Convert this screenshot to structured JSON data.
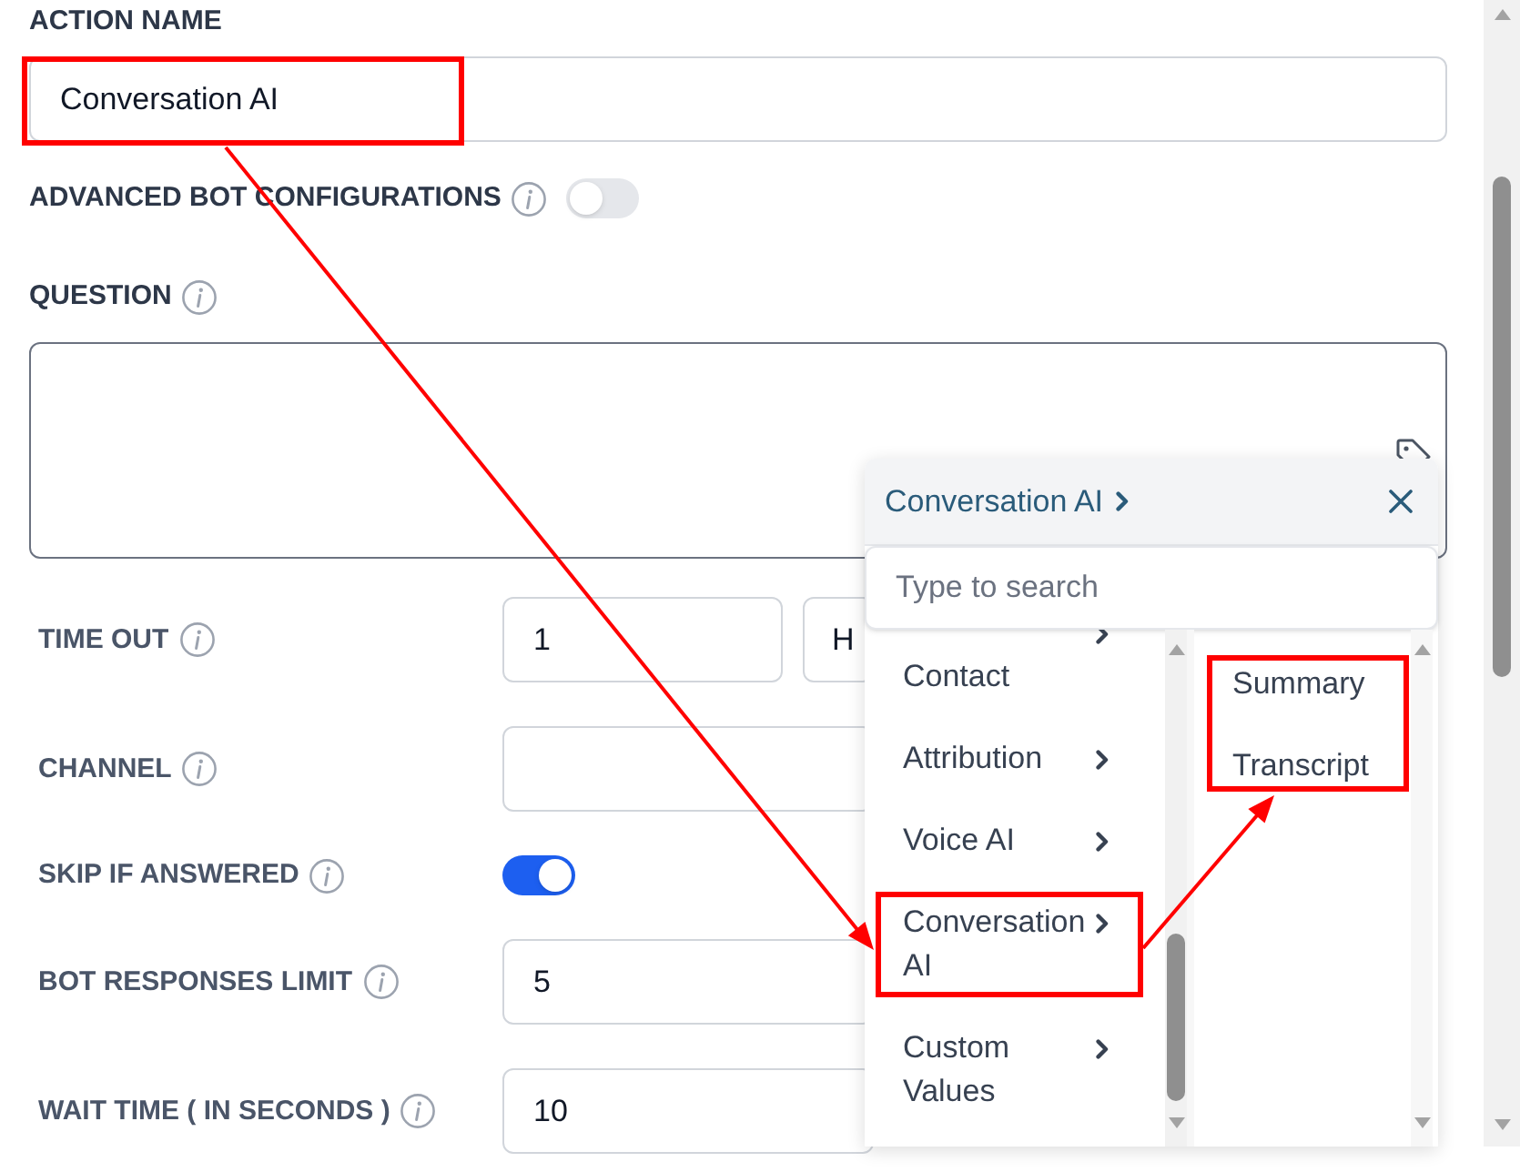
{
  "form": {
    "action_name": {
      "label": "ACTION NAME",
      "value": "Conversation AI",
      "highlighted": true
    },
    "advanced": {
      "label": "ADVANCED BOT CONFIGURATIONS",
      "on": false
    },
    "question": {
      "label": "QUESTION"
    },
    "rows": [
      {
        "kind": "input",
        "label": "TIME OUT",
        "value": "1",
        "select_value": "H"
      },
      {
        "kind": "input",
        "label": "CHANNEL"
      },
      {
        "kind": "toggle",
        "label": "SKIP IF ANSWERED",
        "on": true
      },
      {
        "kind": "input",
        "label": "BOT RESPONSES LIMIT",
        "value": "5"
      },
      {
        "kind": "input",
        "label": "WAIT TIME ( IN SECONDS )",
        "value": "10"
      }
    ]
  },
  "picker": {
    "breadcrumb": "Conversation AI",
    "search": {
      "placeholder": "Type to search"
    },
    "categories": [
      {
        "label": "Contact",
        "highlighted": false
      },
      {
        "label": "Attribution",
        "highlighted": false
      },
      {
        "label": "Voice AI",
        "highlighted": false
      },
      {
        "label": "Conversation AI",
        "highlighted": true
      },
      {
        "label": "Custom Values",
        "highlighted": false
      }
    ],
    "fields": {
      "highlighted": true,
      "items": [
        {
          "label": "Summary"
        },
        {
          "label": "Transcript"
        }
      ]
    }
  }
}
